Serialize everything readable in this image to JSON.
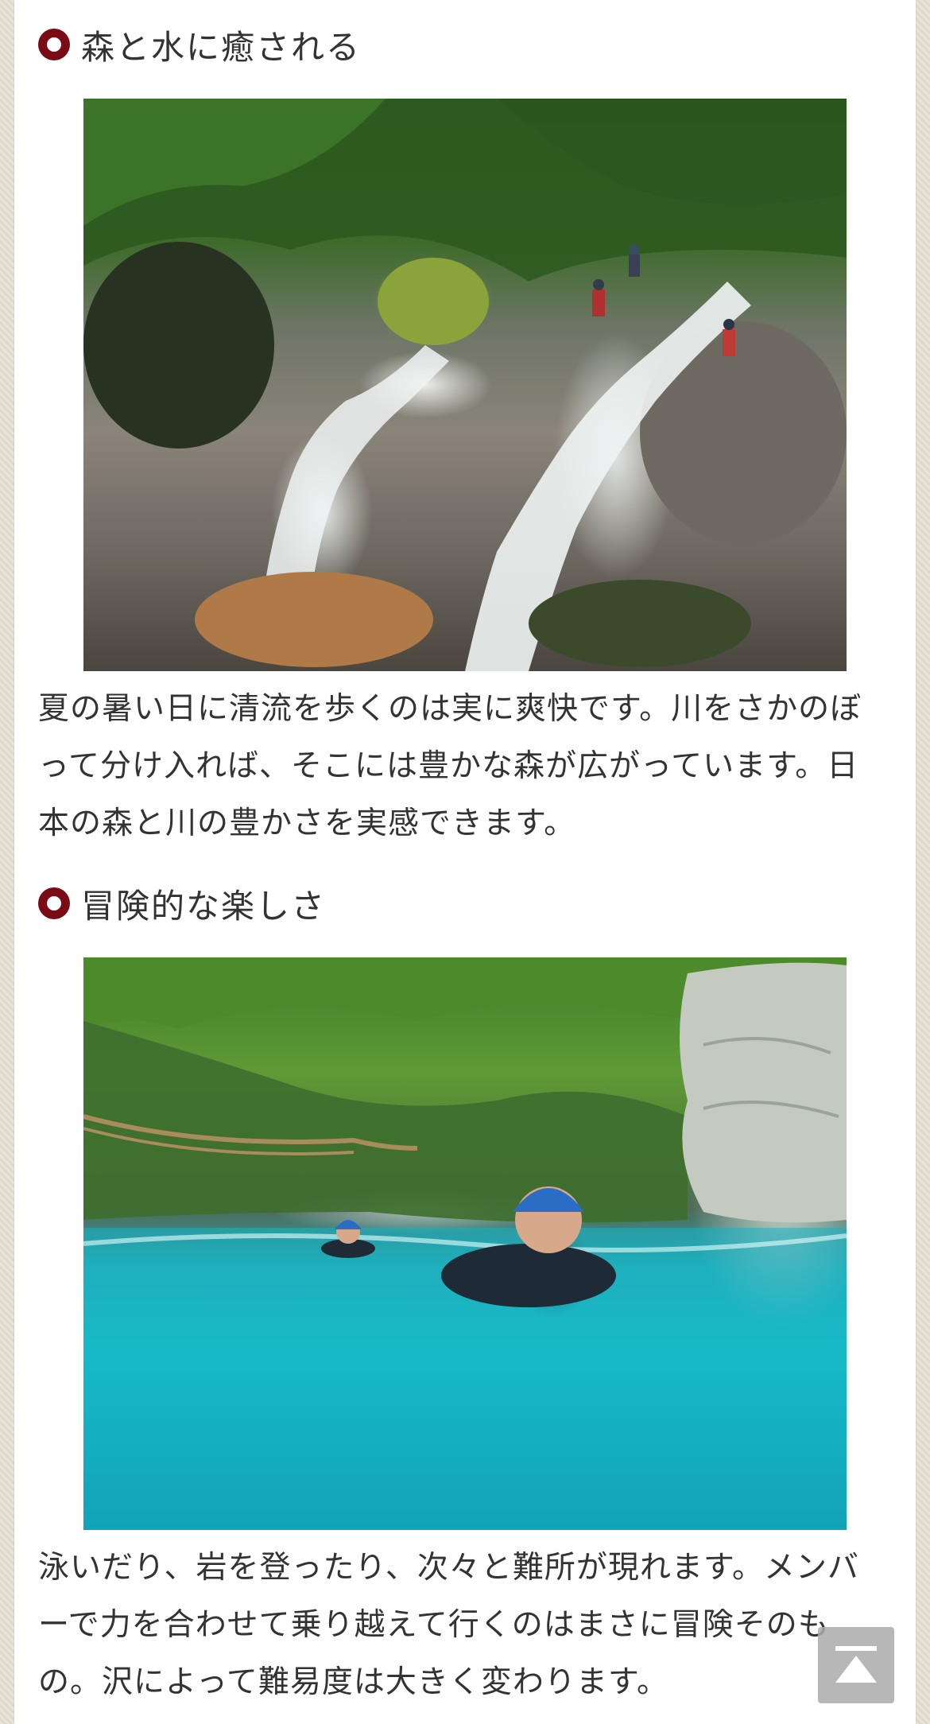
{
  "sections": [
    {
      "heading": "森と水に癒される",
      "image_alt": "waterfall-forest-photo",
      "paragraph": "夏の暑い日に清流を歩くのは実に爽快です。川をさかのぼって分け入れば、そこには豊かな森が広がっています。日本の森と川の豊かさを実感できます。"
    },
    {
      "heading": "冒険的な楽しさ",
      "image_alt": "river-swimming-photo",
      "paragraph": "泳いだり、岩を登ったり、次々と難所が現れます。メンバーで力を合わせて乗り越えて行くのはまさに冒険そのもの。沢によって難易度は大きく変わります。"
    }
  ],
  "back_to_top": {
    "icon": "arrow-to-top-icon"
  },
  "colors": {
    "bullet": "#7a0a14",
    "text": "#333333",
    "background": "#e6e3d6"
  }
}
